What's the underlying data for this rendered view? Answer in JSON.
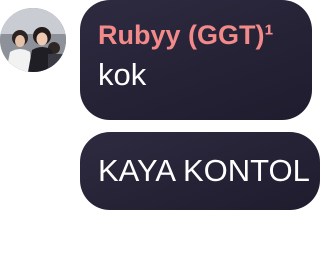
{
  "conversation": {
    "avatar": {
      "icon": "group-photo-avatar"
    },
    "messages": [
      {
        "sender": "Rubyy (GGT)¹",
        "text": "kok"
      },
      {
        "sender": "",
        "text": "KAYA KONTOL"
      }
    ]
  },
  "colors": {
    "bubble": "#2a2638",
    "sender_name": "#f28a8a",
    "message_text": "#ffffff"
  }
}
